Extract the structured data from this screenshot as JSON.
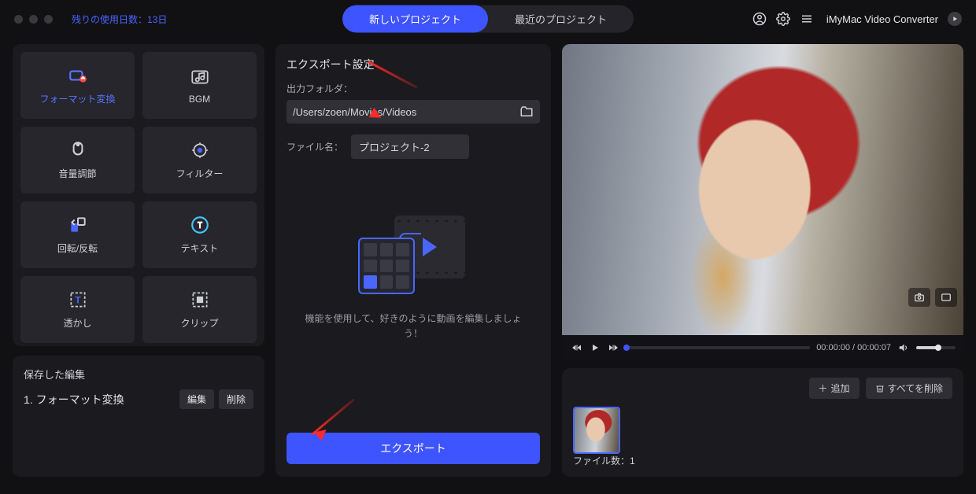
{
  "titlebar": {
    "trial_label": "残りの使用日数：13日",
    "tabs": {
      "new_project": "新しいプロジェクト",
      "recent_projects": "最近のプロジェクト"
    },
    "app_name": "iMyMac Video Converter"
  },
  "tools": {
    "format_convert": "フォーマット変換",
    "bgm": "BGM",
    "volume": "音量調節",
    "filter": "フィルター",
    "rotate": "回転/反転",
    "text": "テキスト",
    "watermark": "透かし",
    "clip": "クリップ"
  },
  "saved": {
    "title": "保存した編集",
    "item1": "1.  フォーマット変換",
    "edit": "編集",
    "delete": "削除"
  },
  "export": {
    "title": "エクスポート設定",
    "folder_label": "出力フォルダ：",
    "folder_path": "/Users/zoen/Movies/Videos",
    "filename_label": "ファイル名：",
    "filename_value": "プロジェクト-2",
    "hint": "機能を使用して、好きのように動画を編集しましょう！",
    "button": "エクスポート"
  },
  "player": {
    "time": "00:00:00 / 00:00:07"
  },
  "files": {
    "add": "追加",
    "delete_all": "すべてを削除",
    "count_label": "ファイル数：1"
  }
}
